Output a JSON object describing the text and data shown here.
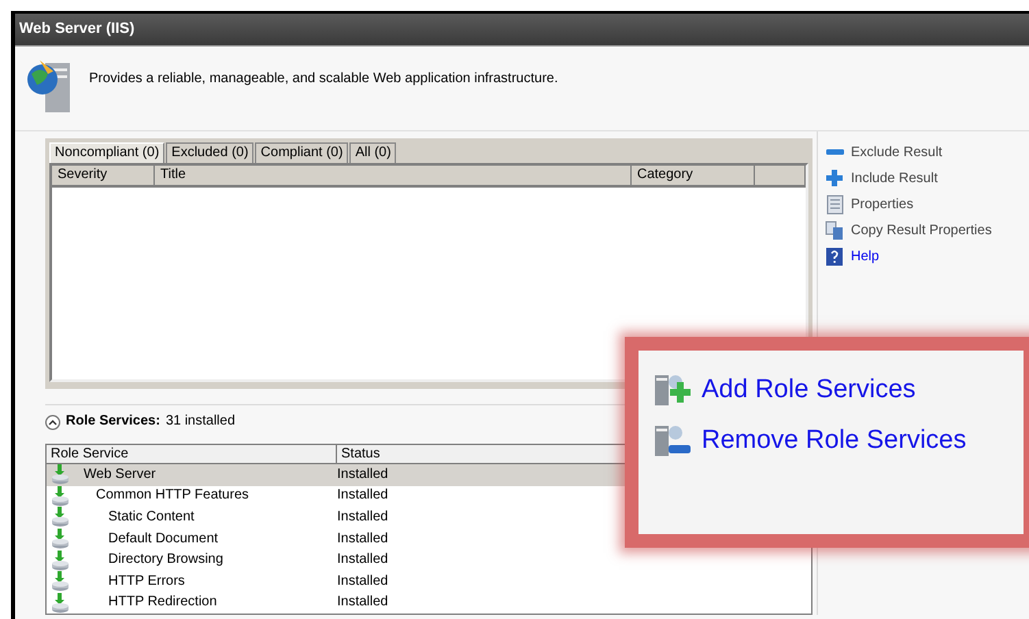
{
  "window": {
    "title": "Web Server (IIS)"
  },
  "description": "Provides a reliable, manageable, and scalable Web application infrastructure.",
  "result_tabs": [
    {
      "label": "Noncompliant (0)",
      "selected": true
    },
    {
      "label": "Excluded (0)",
      "selected": false
    },
    {
      "label": "Compliant (0)",
      "selected": false
    },
    {
      "label": "All (0)",
      "selected": false
    }
  ],
  "results_table": {
    "columns": [
      "Severity",
      "Title",
      "Category"
    ]
  },
  "actions": [
    {
      "kind": "exclude",
      "label": "Exclude Result",
      "link": false
    },
    {
      "kind": "include",
      "label": "Include Result",
      "link": false
    },
    {
      "kind": "properties",
      "label": "Properties",
      "link": false
    },
    {
      "kind": "copy",
      "label": "Copy Result Properties",
      "link": false
    },
    {
      "kind": "help",
      "label": "Help",
      "link": true
    }
  ],
  "role_services": {
    "title": "Role Services:",
    "count": "31 installed",
    "expanded": true,
    "columns": [
      "Role Service",
      "Status"
    ],
    "rows": [
      {
        "name": "Web Server",
        "status": "Installed",
        "selected": true,
        "children": [
          {
            "name": "Common HTTP Features",
            "status": "Installed",
            "selected": false,
            "children": [
              {
                "name": "Static Content",
                "status": "Installed",
                "selected": false
              },
              {
                "name": "Default Document",
                "status": "Installed",
                "selected": false
              },
              {
                "name": "Directory Browsing",
                "status": "Installed",
                "selected": false
              },
              {
                "name": "HTTP Errors",
                "status": "Installed",
                "selected": false
              },
              {
                "name": "HTTP Redirection",
                "status": "Installed",
                "selected": false
              }
            ]
          }
        ]
      }
    ]
  },
  "callout": {
    "items": [
      {
        "kind": "add",
        "label": "Add Role Services"
      },
      {
        "kind": "remove",
        "label": "Remove Role Services"
      }
    ]
  }
}
